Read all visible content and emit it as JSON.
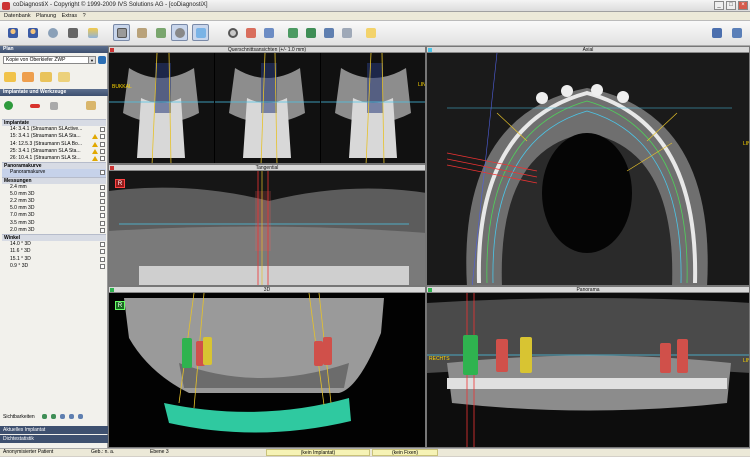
{
  "window": {
    "title": "coDiagnostiX - Copyright © 1999-2009 IVS Solutions AG - [coDiagnostiX]"
  },
  "menu": [
    "Datenbank",
    "Planung",
    "Extras",
    "?"
  ],
  "sidebar": {
    "header_plan": "Plan",
    "plan_select": "Kopie von Oberkiefer ZWP",
    "header_tools": "Implantate und Werkzeuge",
    "groups": [
      {
        "label": "Implantate",
        "items": [
          {
            "label": "14: 3.4.1 (Straumann SLActive...",
            "warn": false
          },
          {
            "label": "15: 3.4.1 (Straumann SLA Sta...",
            "warn": true
          },
          {
            "label": "14: 12.5.3 (Straumann SLA Bo...",
            "warn": true
          },
          {
            "label": "25: 3.4.1 (Straumann SLA Sta...",
            "warn": true
          },
          {
            "label": "26: 10.4.1 (Straumann SLA St...",
            "warn": true
          }
        ]
      },
      {
        "label": "Panoramakurve",
        "items": [
          {
            "label": "Panoramakurve",
            "warn": false
          }
        ]
      },
      {
        "label": "Messungen",
        "items": [
          {
            "label": "2.4 mm",
            "warn": false
          },
          {
            "label": "5.0 mm 3D",
            "warn": false
          },
          {
            "label": "2.2 mm 3D",
            "warn": false
          },
          {
            "label": "5.0 mm 3D",
            "warn": false
          },
          {
            "label": "7.0 mm 3D",
            "warn": false
          },
          {
            "label": "3.5 mm 3D",
            "warn": false
          },
          {
            "label": "2.0 mm 3D",
            "warn": false
          }
        ]
      },
      {
        "label": "Winkel",
        "items": [
          {
            "label": "14.0 ° 3D",
            "warn": false
          },
          {
            "label": "11.6 ° 3D",
            "warn": false
          },
          {
            "label": "15.1 ° 3D",
            "warn": false
          },
          {
            "label": "0.9 ° 3D",
            "warn": false
          }
        ]
      }
    ],
    "visibility_label": "Sichtbarkeiten",
    "bottom_panels": [
      "Aktuelles Implantat",
      "Dichtestatistik"
    ]
  },
  "viewports": {
    "cross": {
      "title": "Querschnittsansichten (+/- 1.0 mm)",
      "left_label": "BUKKAL",
      "right_label": "LINGUAL"
    },
    "axial": {
      "title": "Axial",
      "right_label": "LINKS"
    },
    "tangential": {
      "title": "Tangential",
      "marker": "R"
    },
    "three_d": {
      "title": "3D",
      "marker": "R"
    },
    "panorama": {
      "title": "Panorama",
      "left_label": "RECHTS",
      "right_label": "LINKS"
    }
  },
  "status": {
    "patient": "Anonymisierter Patient",
    "birth": "Geb.: n. a.",
    "plane": "Ebene 3",
    "box1": "(kein Implantat)",
    "box2": "(kein Fixen)"
  },
  "colors": {
    "accent_header": "#3e506f",
    "implant_green": "#2fb34f",
    "implant_red": "#d0504a",
    "implant_yellow": "#d8c432",
    "guide_teal": "#2fc9a0"
  }
}
